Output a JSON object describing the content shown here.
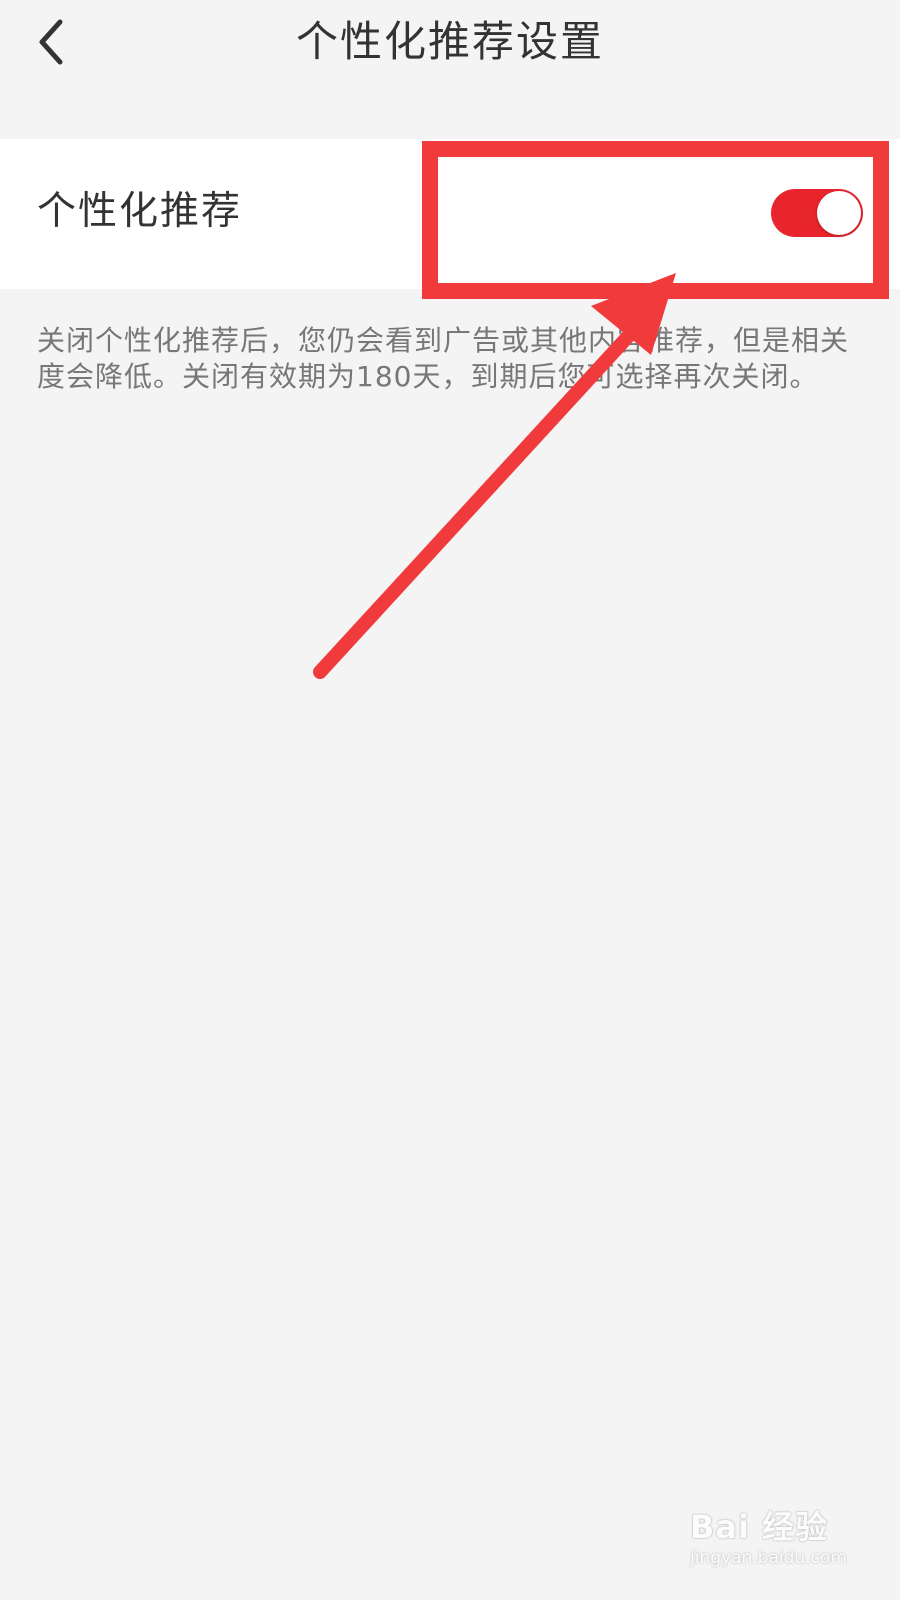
{
  "header": {
    "back_icon": "chevron-left-icon",
    "title": "个性化推荐设置"
  },
  "setting": {
    "label": "个性化推荐",
    "toggle_on": true,
    "toggle_color": "#e8252c"
  },
  "description": "关闭个性化推荐后，您仍会看到广告或其他内容推荐，但是相关度会降低。关闭有效期为180天，到期后您可选择再次关闭。",
  "annotation": {
    "color": "#f03a3c"
  },
  "watermark": {
    "logo": "Bai 经验",
    "url": "jingyan.baidu.com"
  }
}
